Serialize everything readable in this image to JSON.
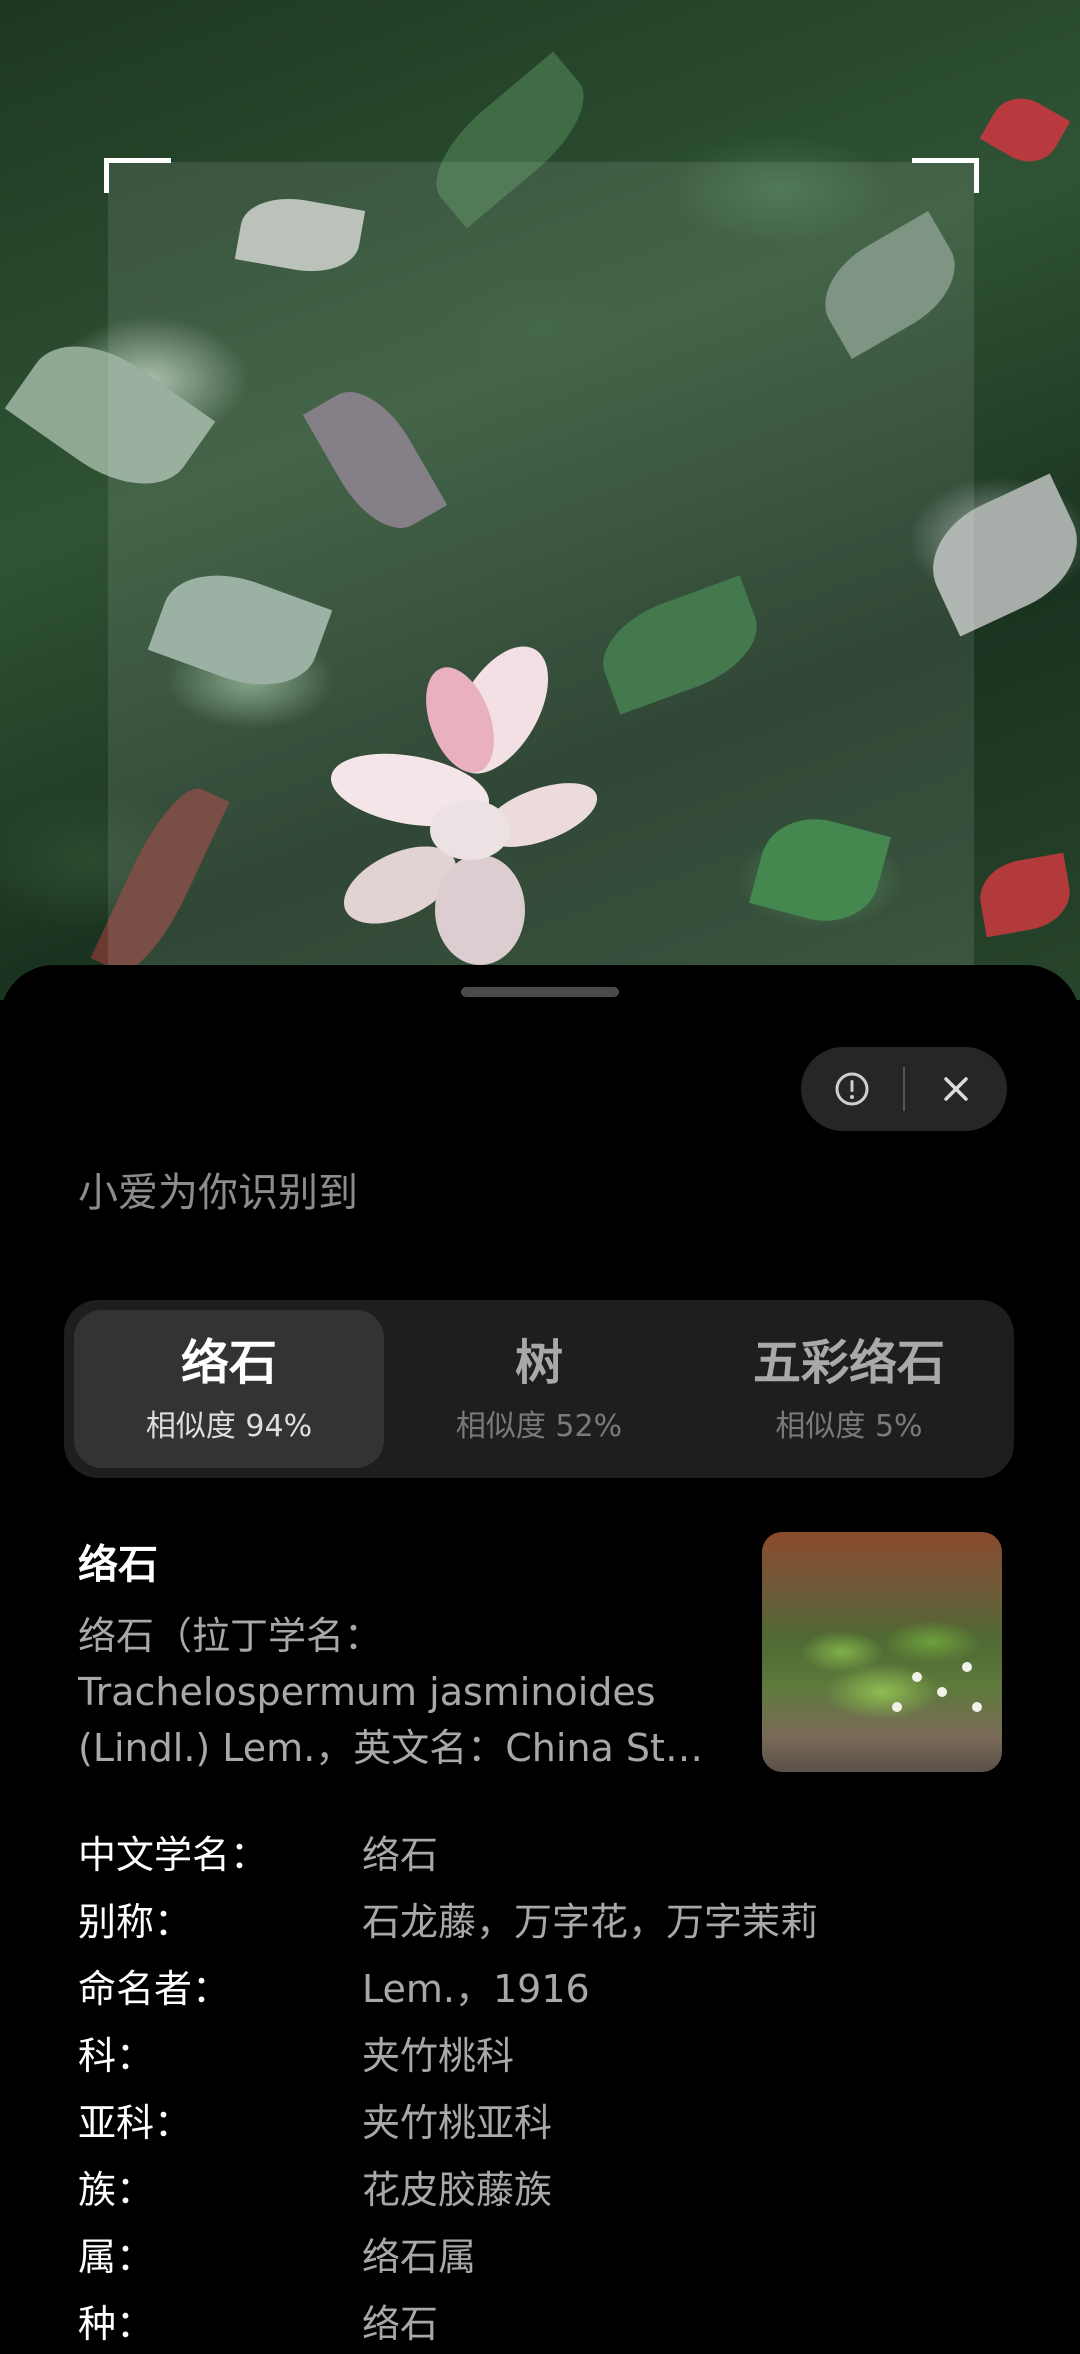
{
  "header": {
    "recognition_label": "小爱为你识别到"
  },
  "actions": {
    "report_icon": "exclamation-circle-icon",
    "close_icon": "close-icon"
  },
  "candidates": [
    {
      "name": "络石",
      "similarity": "相似度 94%",
      "selected": true
    },
    {
      "name": "树",
      "similarity": "相似度 52%",
      "selected": false
    },
    {
      "name": "五彩络石",
      "similarity": "相似度 5%",
      "selected": false
    }
  ],
  "detail": {
    "title": "络石",
    "description": "络石（拉丁学名：Trachelospermum jasminoides (Lindl.) Lem.，英文名：China Star Jasmine",
    "properties": [
      {
        "label": "中文学名：",
        "value": "络石"
      },
      {
        "label": "别称：",
        "value": "石龙藤，万字花，万字茉莉"
      },
      {
        "label": "命名者：",
        "value": "Lem.，1916"
      },
      {
        "label": "科：",
        "value": "夹竹桃科"
      },
      {
        "label": "亚科：",
        "value": "夹竹桃亚科"
      },
      {
        "label": "族：",
        "value": "花皮胶藤族"
      },
      {
        "label": "属：",
        "value": "络石属"
      },
      {
        "label": "种：",
        "value": "络石"
      }
    ]
  },
  "colors": {
    "sheet_background": "#000000",
    "tab_active": "#333333",
    "tab_bar": "#1e1e1e"
  }
}
